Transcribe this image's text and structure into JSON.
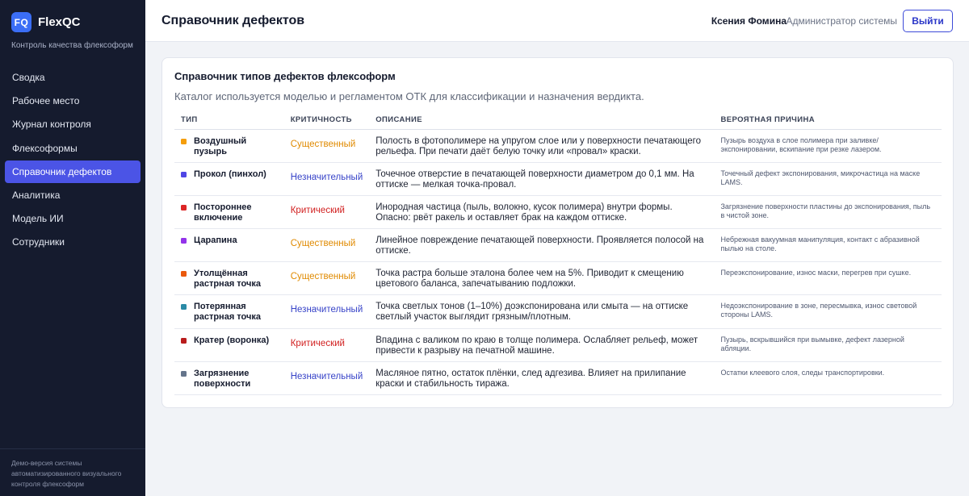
{
  "app": {
    "logo_text": "FQ",
    "name": "FlexQC",
    "subtitle": "Контроль качества флексоформ"
  },
  "sidebar": {
    "items": [
      {
        "label": "Сводка",
        "active": false
      },
      {
        "label": "Рабочее место",
        "active": false
      },
      {
        "label": "Журнал контроля",
        "active": false
      },
      {
        "label": "Флексоформы",
        "active": false
      },
      {
        "label": "Справочник дефектов",
        "active": true
      },
      {
        "label": "Аналитика",
        "active": false
      },
      {
        "label": "Модель ИИ",
        "active": false
      },
      {
        "label": "Сотрудники",
        "active": false
      }
    ],
    "footer": "Демо-версия системы автоматизированного визуального контроля флексоформ"
  },
  "header": {
    "title": "Справочник дефектов",
    "user_name": "Ксения Фомина",
    "user_role": "Администратор системы",
    "logout_label": "Выйти"
  },
  "card": {
    "title": "Справочник типов дефектов флексоформ",
    "description": "Каталог используется моделью и регламентом ОТК для классификации и назначения вердикта."
  },
  "table": {
    "headers": [
      "ТИП",
      "КРИТИЧНОСТЬ",
      "ОПИСАНИЕ",
      "ВЕРОЯТНАЯ ПРИЧИНА"
    ],
    "rows": [
      {
        "type": "Воздушный пузырь",
        "marker_color": "#f59e0b",
        "severity": "Существенный",
        "severity_color": "#e08a00",
        "description": "Полость в фотополимере на упругом слое или у поверхности печатающего рельефа. При печати даёт белую точку или «провал» краски.",
        "cause": "Пузырь воздуха в слое полимера при заливке/экспонировании, вскипание при резке лазером."
      },
      {
        "type": "Прокол (пинхол)",
        "marker_color": "#4f46e5",
        "severity": "Незначительный",
        "severity_color": "#3743c8",
        "description": "Точечное отверстие в печатающей поверхности диаметром до 0,1 мм. На оттиске — мелкая точка-провал.",
        "cause": "Точечный дефект экспонирования, микрочастица на маске LAMS."
      },
      {
        "type": "Постороннее включение",
        "marker_color": "#dc2626",
        "severity": "Критический",
        "severity_color": "#d11f1f",
        "description": "Инородная частица (пыль, волокно, кусок полимера) внутри формы. Опасно: рвёт ракель и оставляет брак на каждом оттиске.",
        "cause": "Загрязнение поверхности пластины до экспонирования, пыль в чистой зоне."
      },
      {
        "type": "Царапина",
        "marker_color": "#9333ea",
        "severity": "Существенный",
        "severity_color": "#e08a00",
        "description": "Линейное повреждение печатающей поверхности. Проявляется полосой на оттиске.",
        "cause": "Небрежная вакуумная манипуляция, контакт с абразивной пылью на столе."
      },
      {
        "type": "Утолщённая растрная точка",
        "marker_color": "#ea580c",
        "severity": "Существенный",
        "severity_color": "#e08a00",
        "description": "Точка растра больше эталона более чем на 5%. Приводит к смещению цветового баланса, запечатыванию подложки.",
        "cause": "Переэкспонирование, износ маски, перегрев при сушке."
      },
      {
        "type": "Потерянная растрная точка",
        "marker_color": "#2b8aa6",
        "severity": "Незначительный",
        "severity_color": "#3743c8",
        "description": "Точка светлых тонов (1–10%) доэкспонирована или смыта — на оттиске светлый участок выглядит грязным/плотным.",
        "cause": "Недоэкспонирование в зоне, пересмывка, износ световой стороны LAMS."
      },
      {
        "type": "Кратер (воронка)",
        "marker_color": "#b91c1c",
        "severity": "Критический",
        "severity_color": "#d11f1f",
        "description": "Впадина с валиком по краю в толще полимера. Ослабляет рельеф, может привести к разрыву на печатной машине.",
        "cause": "Пузырь, вскрывшийся при вымывке, дефект лазерной абляции."
      },
      {
        "type": "Загрязнение поверхности",
        "marker_color": "#64748b",
        "severity": "Незначительный",
        "severity_color": "#3743c8",
        "description": "Масляное пятно, остаток плёнки, след адгезива. Влияет на прилипание краски и стабильность тиража.",
        "cause": "Остатки клеевого слоя, следы транспортировки."
      }
    ]
  }
}
